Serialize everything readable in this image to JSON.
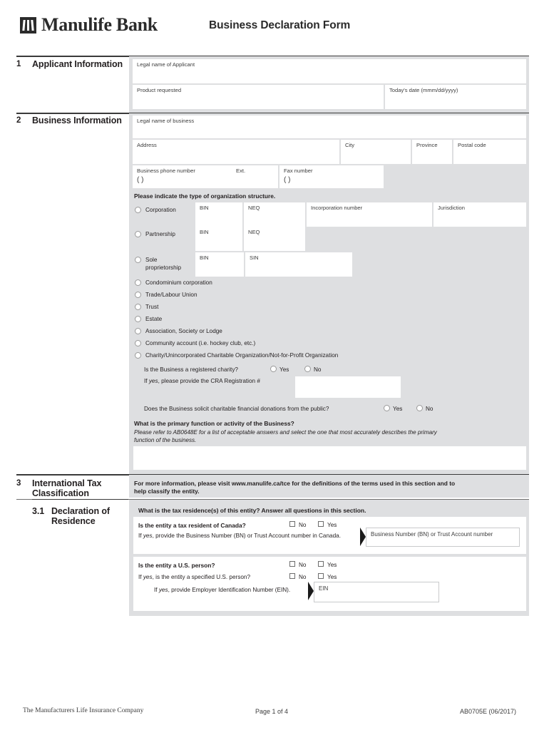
{
  "header": {
    "logo_icon": "manulife-logo-mark",
    "brand": "Manulife Bank",
    "title": "Business Declaration Form"
  },
  "sections": {
    "applicant": {
      "number": "1",
      "name": "Applicant Information",
      "fields": {
        "legal_name": "Legal name of Applicant",
        "product": "Product requested",
        "date": "Today's date (mmm/dd/yyyy)"
      }
    },
    "business": {
      "number": "2",
      "name": "Business Information",
      "fields": {
        "legal_name": "Legal name of business",
        "address": "Address",
        "city": "City",
        "province": "Province",
        "postal": "Postal code",
        "phone": "Business phone number",
        "ext": "Ext.",
        "fax": "Fax number",
        "paren": "(            )"
      },
      "org_prompt": "Please indicate the type of organization structure.",
      "org_rows": [
        {
          "label": "Corporation",
          "boxes": [
            "BIN",
            "NEQ",
            "Incorporation number",
            "Jurisdiction"
          ]
        },
        {
          "label": "Partnership",
          "boxes": [
            "BIN",
            "NEQ"
          ]
        },
        {
          "label": "Sole proprietorship",
          "label_l1": "Sole",
          "label_l2": "proprietorship",
          "boxes": [
            "BIN",
            "SIN"
          ]
        }
      ],
      "org_options": [
        "Condominium corporation",
        "Trade/Labour Union",
        "Trust",
        "Estate",
        "Association, Society or Lodge",
        "Community account (i.e. hockey club, etc.)",
        "Charity/Unincorporated Charitable Organization/Not-for-Profit Organization"
      ],
      "charity": {
        "q1": "Is the Business a registered charity?",
        "yes": "Yes",
        "no": "No",
        "q2_pre": "If ",
        "q2_it": "yes",
        "q2_post": ", please provide the CRA Registration #",
        "q3": "Does the Business solicit charitable financial donations from the public?"
      },
      "primary": {
        "question": "What is the primary function or activity of the Business?",
        "note_l1": "Please refer to AB0648E for a list of acceptable answers and select the one that most accurately describes the primary",
        "note_l2": "function of the business."
      }
    },
    "tax": {
      "number": "3",
      "name_l1": "International Tax",
      "name_l2": "Classification",
      "intro_l1": "For more information, please visit www.manulife.ca/tce for the definitions of the terms used in this section and to",
      "intro_l2": "help classify the entity.",
      "sub": {
        "number": "3.1",
        "name_l1": "Declaration of",
        "name_l2": "Residence",
        "heading": "What is the tax residence(s) of this entity? Answer all questions in this section.",
        "no": "No",
        "yes": "Yes",
        "q_canada": "Is the entity a tax resident of Canada?",
        "q_canada_note_pre": "If ",
        "q_canada_note_it": "yes",
        "q_canada_note_post": ", provide the Business Number (BN) or Trust Account number in Canada.",
        "bn_field": "Business Number (BN) or Trust Account number",
        "q_us": "Is the entity a U.S. person?",
        "q_us_spec_pre": "If ",
        "q_us_spec_it": "yes",
        "q_us_spec_post": ", is the entity a specified U.S. person?",
        "q_ein_pre": "If ",
        "q_ein_it": "yes",
        "q_ein_post": ", provide Employer Identification Number (EIN).",
        "ein_field": "EIN"
      }
    }
  },
  "footer": {
    "company": "The Manufacturers Life Insurance Company",
    "page": "Page 1 of 4",
    "code": "AB0705E (06/2017)"
  }
}
